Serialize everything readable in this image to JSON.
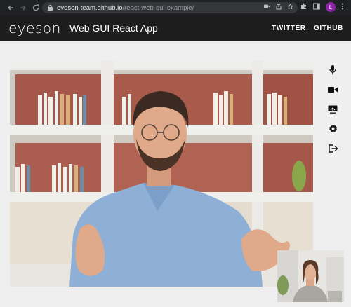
{
  "browser": {
    "url_host": "eyeson-team.github.io",
    "url_path": "/react-web-gui-example/",
    "profile_initial": "L",
    "profile_color": "#8e24aa"
  },
  "header": {
    "logo_text": "eyeson",
    "title": "Web GUI React App",
    "nav": [
      "TWITTER",
      "GITHUB"
    ]
  },
  "toolbar": {
    "icons": [
      "microphone-icon",
      "camera-icon",
      "screen-share-icon",
      "settings-icon",
      "exit-icon"
    ]
  },
  "colors": {
    "header_bg": "#1d1d1d",
    "browser_bg": "#202124",
    "page_bg": "#efefef"
  }
}
